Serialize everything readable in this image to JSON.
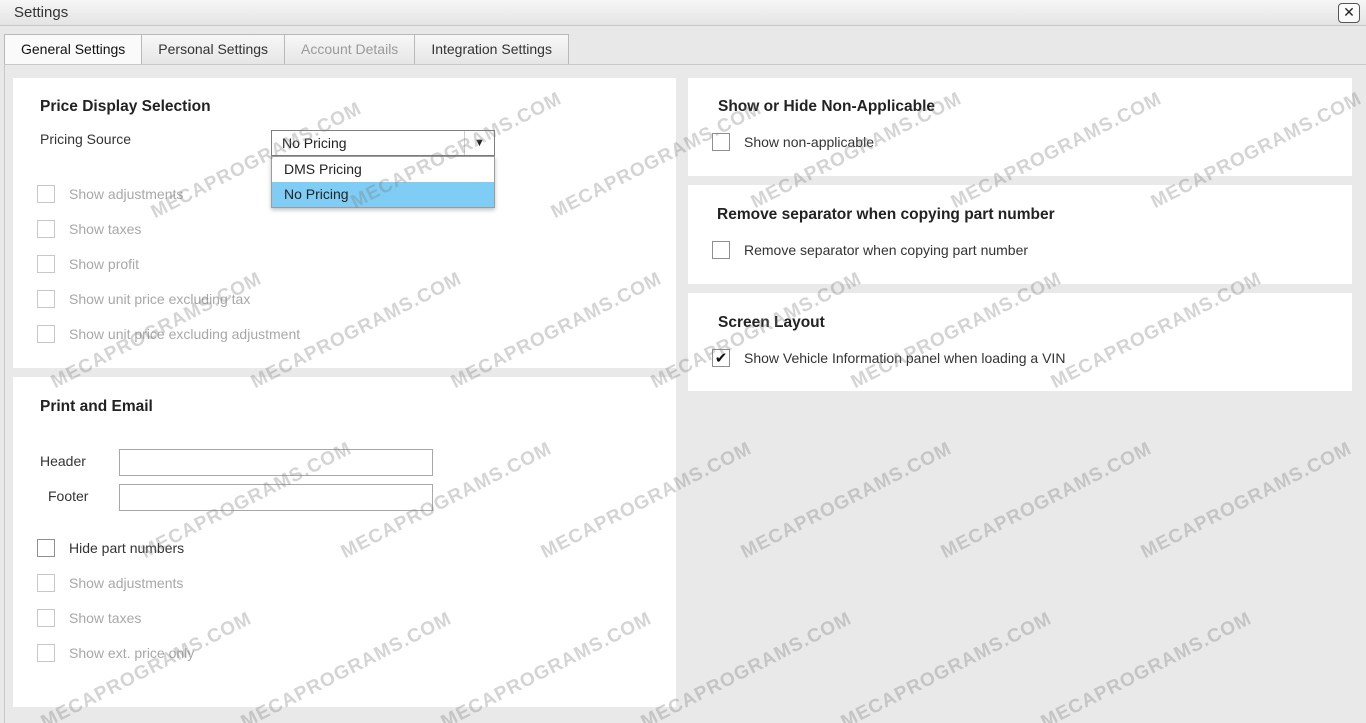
{
  "window": {
    "title": "Settings",
    "close_glyph": "✕"
  },
  "tabs": [
    {
      "label": "General Settings",
      "state": "active"
    },
    {
      "label": "Personal Settings",
      "state": "normal"
    },
    {
      "label": "Account Details",
      "state": "disabled"
    },
    {
      "label": "Integration Settings",
      "state": "normal"
    }
  ],
  "price_display": {
    "title": "Price Display Selection",
    "pricing_source_label": "Pricing Source",
    "pricing_source_value": "No Pricing",
    "dropdown_arrow": "▼",
    "dropdown_options": [
      {
        "label": "DMS Pricing",
        "selected": false
      },
      {
        "label": "No Pricing",
        "selected": true
      }
    ],
    "checkboxes": [
      {
        "label": "Show adjustments",
        "checked": false,
        "disabled": true
      },
      {
        "label": "Show taxes",
        "checked": false,
        "disabled": true
      },
      {
        "label": "Show profit",
        "checked": false,
        "disabled": true
      },
      {
        "label": "Show unit price excluding tax",
        "checked": false,
        "disabled": true
      },
      {
        "label": "Show unit price excluding adjustment",
        "checked": false,
        "disabled": true
      }
    ]
  },
  "print_email": {
    "title": "Print and Email",
    "header_label": "Header",
    "header_value": "",
    "footer_label": "Footer",
    "footer_value": "",
    "checkboxes": [
      {
        "label": "Hide part numbers",
        "checked": false,
        "disabled": false
      },
      {
        "label": "Show adjustments",
        "checked": false,
        "disabled": true
      },
      {
        "label": "Show taxes",
        "checked": false,
        "disabled": true
      },
      {
        "label": "Show ext. price only",
        "checked": false,
        "disabled": true
      }
    ]
  },
  "non_applicable": {
    "title": "Show or Hide Non-Applicable",
    "checkbox": {
      "label": "Show non-applicable",
      "checked": false,
      "disabled": false
    }
  },
  "separator": {
    "title": "Remove separator when copying part number",
    "checkbox": {
      "label": "Remove separator when copying part number",
      "checked": false,
      "disabled": false
    }
  },
  "screen_layout": {
    "title": "Screen Layout",
    "checkbox": {
      "label": "Show Vehicle Information panel when loading a VIN",
      "checked": true,
      "disabled": false
    }
  },
  "check_glyph": "✔",
  "watermark_text": "MECAPROGRAMS.COM",
  "colors": {
    "dropdown_selected": "#7fcdf5",
    "panel_bg": "#ffffff",
    "body_bg": "#e9e9e9"
  }
}
